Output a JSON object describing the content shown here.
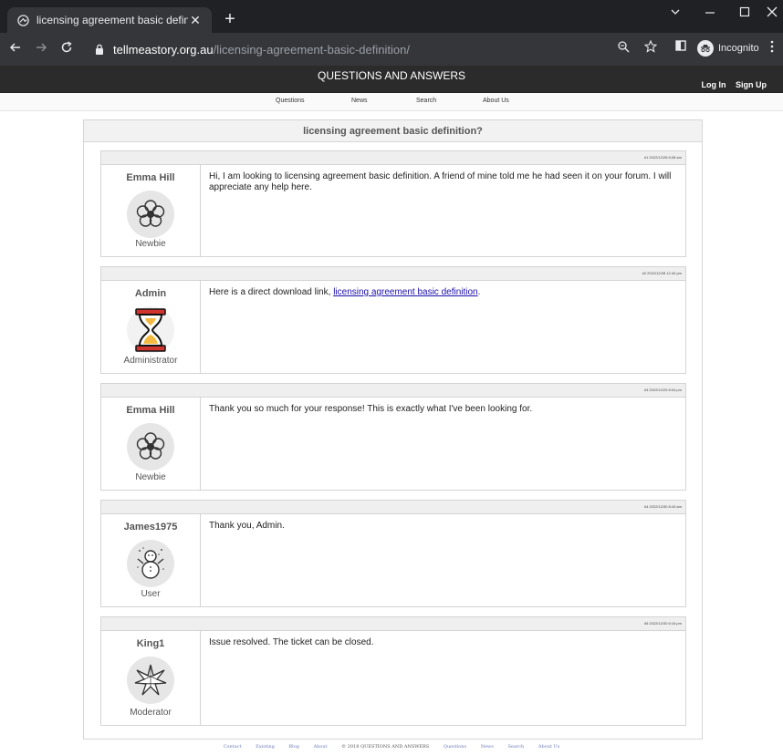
{
  "browser": {
    "tab_title": "licensing agreement basic definit",
    "tab_close": "✕",
    "new_tab": "+",
    "url_host": "tellmeastory.org.au",
    "url_path": "/licensing-agreement-basic-definition/",
    "profile_label": "Incognito",
    "icons": [
      "back-icon",
      "forward-icon",
      "reload-icon",
      "lock-icon",
      "zoom-icon",
      "star-icon",
      "sidepanel-icon",
      "incognito-icon",
      "menu-icon"
    ]
  },
  "site": {
    "title": "QUESTIONS AND ANSWERS",
    "login": "Log In",
    "signup": "Sign Up",
    "nav": [
      "Questions",
      "News",
      "Search",
      "About Us"
    ]
  },
  "thread": {
    "title": "licensing agreement basic definition?",
    "posts": [
      {
        "meta": "#1 2022/12/28 6:08 am",
        "author": "Emma Hill",
        "role": "Newbie",
        "avatar": "flower-icon",
        "text": "Hi, I am looking to licensing agreement basic definition. A friend of mine told me he had seen it on your forum. I will appreciate any help here."
      },
      {
        "meta": "#2 2022/12/28 12:40 pm",
        "author": "Admin",
        "role": "Administrator",
        "avatar": "hourglass-icon",
        "text_before": "Here is a direct download link, ",
        "link": "licensing agreement basic definition",
        "text_after": "."
      },
      {
        "meta": "#3 2022/12/29 8:04 pm",
        "author": "Emma Hill",
        "role": "Newbie",
        "avatar": "flower-icon",
        "text": "Thank you so much for your response! This is exactly what I've been looking for."
      },
      {
        "meta": "#4 2022/12/30 8:43 am",
        "author": "James1975",
        "role": "User",
        "avatar": "snowman-icon",
        "text": "Thank you, Admin."
      },
      {
        "meta": "#5 2022/12/30 6:16 pm",
        "author": "King1",
        "role": "Moderator",
        "avatar": "star-icon",
        "text": "Issue resolved. The ticket can be closed."
      }
    ]
  },
  "footer": {
    "links_left": [
      "Contact",
      "Existing",
      "Blog",
      "About"
    ],
    "copyright": "© 2018 QUESTIONS AND ANSWERS",
    "links_right": [
      "Questions",
      "News",
      "Search",
      "About Us"
    ]
  }
}
